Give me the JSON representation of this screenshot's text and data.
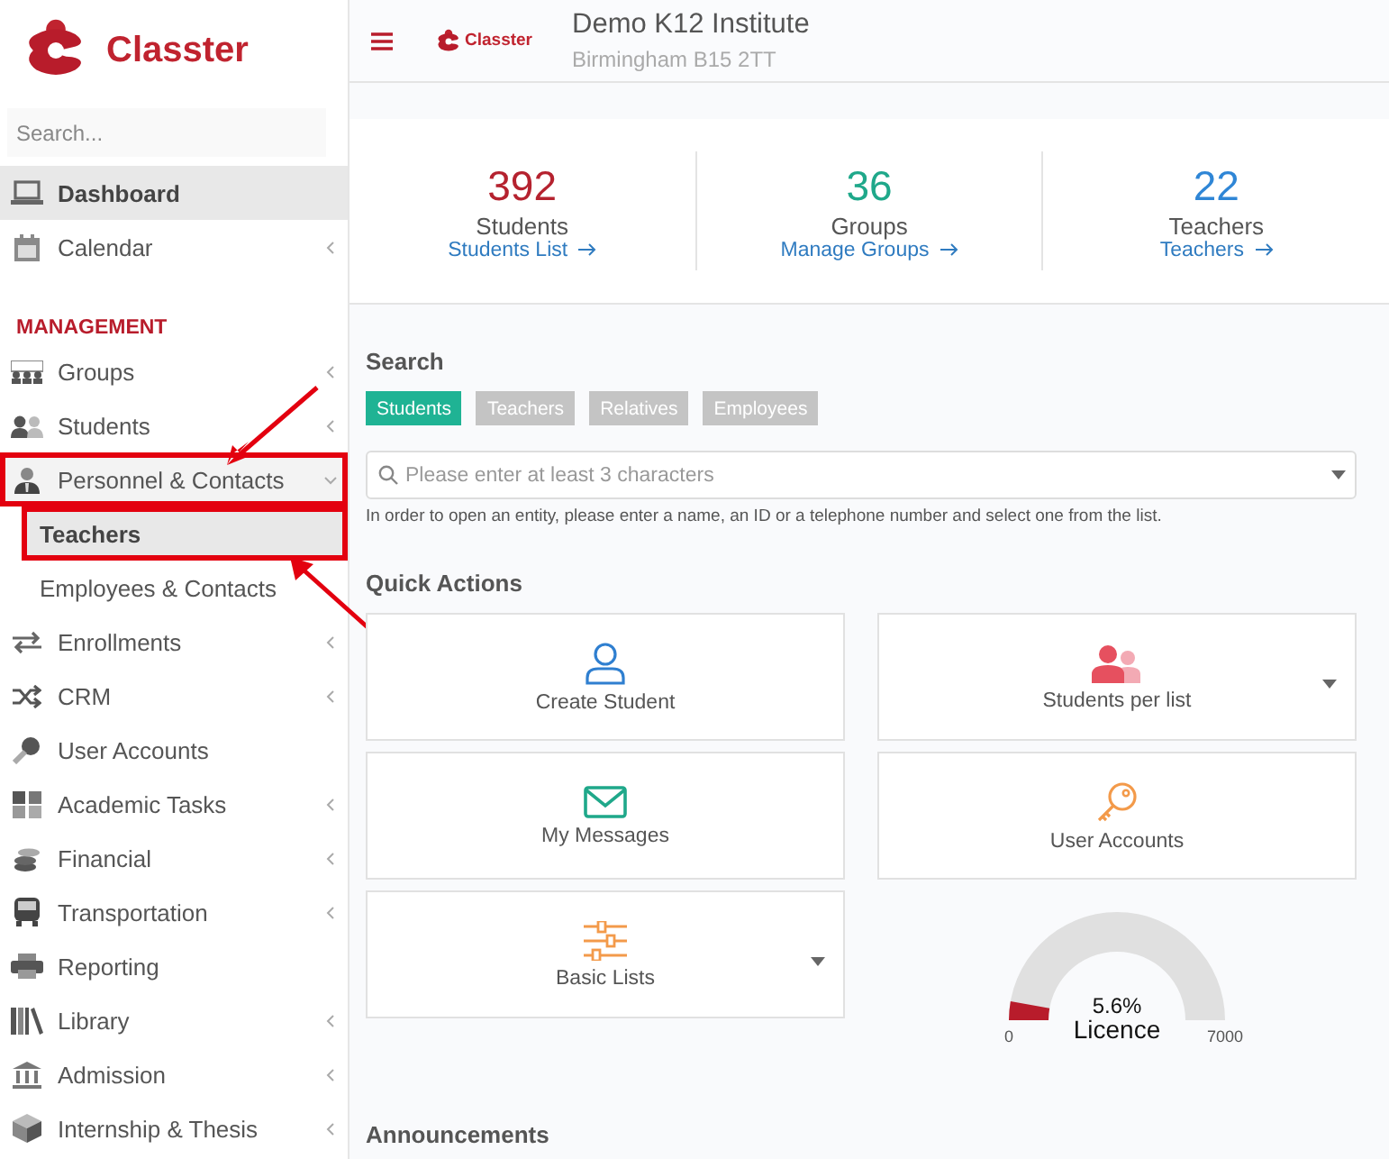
{
  "sidebar": {
    "logo_text": "Classter",
    "search": {
      "placeholder": "Search..."
    },
    "items": [
      {
        "kind": "item",
        "label": "Dashboard",
        "selected": true,
        "expandable": false,
        "highlighted": false
      },
      {
        "kind": "item",
        "label": "Calendar",
        "selected": false,
        "expandable": true,
        "expanded": false,
        "highlighted": false
      },
      {
        "kind": "section",
        "label": "MANAGEMENT"
      },
      {
        "kind": "item",
        "label": "Groups",
        "selected": false,
        "expandable": true,
        "expanded": false,
        "highlighted": false
      },
      {
        "kind": "item",
        "label": "Students",
        "selected": false,
        "expandable": true,
        "expanded": false,
        "highlighted": false
      },
      {
        "kind": "item",
        "label": "Personnel & Contacts",
        "selected": false,
        "expandable": true,
        "expanded": true,
        "highlighted": true
      },
      {
        "kind": "subitem",
        "label": "Teachers",
        "selected": true,
        "highlighted": true
      },
      {
        "kind": "subitem",
        "label": "Employees & Contacts",
        "selected": false,
        "highlighted": false
      },
      {
        "kind": "item",
        "label": "Enrollments",
        "selected": false,
        "expandable": true,
        "expanded": false,
        "highlighted": false
      },
      {
        "kind": "item",
        "label": "CRM",
        "selected": false,
        "expandable": true,
        "expanded": false,
        "highlighted": false
      },
      {
        "kind": "item",
        "label": "User Accounts",
        "selected": false,
        "expandable": false,
        "highlighted": false
      },
      {
        "kind": "item",
        "label": "Academic Tasks",
        "selected": false,
        "expandable": true,
        "expanded": false,
        "highlighted": false
      },
      {
        "kind": "item",
        "label": "Financial",
        "selected": false,
        "expandable": true,
        "expanded": false,
        "highlighted": false
      },
      {
        "kind": "item",
        "label": "Transportation",
        "selected": false,
        "expandable": true,
        "expanded": false,
        "highlighted": false
      },
      {
        "kind": "item",
        "label": "Reporting",
        "selected": false,
        "expandable": false,
        "highlighted": false
      },
      {
        "kind": "item",
        "label": "Library",
        "selected": false,
        "expandable": true,
        "expanded": false,
        "highlighted": false
      },
      {
        "kind": "item",
        "label": "Admission",
        "selected": false,
        "expandable": true,
        "expanded": false,
        "highlighted": false
      },
      {
        "kind": "item",
        "label": "Internship & Thesis",
        "selected": false,
        "expandable": true,
        "expanded": false,
        "highlighted": false
      }
    ]
  },
  "header": {
    "logo_text": "Classter",
    "title": "Demo K12 Institute",
    "subtitle": "Birmingham B15 2TT"
  },
  "stats": [
    {
      "value": "392",
      "label": "Students",
      "link": "Students List",
      "color": "#b5222f"
    },
    {
      "value": "36",
      "label": "Groups",
      "link": "Manage Groups",
      "color": "#1fa88a"
    },
    {
      "value": "22",
      "label": "Teachers",
      "link": "Teachers",
      "color": "#2f86d6"
    }
  ],
  "search": {
    "title": "Search",
    "tabs": [
      {
        "label": "Students",
        "selected": true
      },
      {
        "label": "Teachers",
        "selected": false
      },
      {
        "label": "Relatives",
        "selected": false
      },
      {
        "label": "Employees",
        "selected": false
      }
    ],
    "placeholder": "Please enter at least 3 characters",
    "help": "In order to open an entity, please enter a name, an ID or a telephone number and select one from the list."
  },
  "quick_actions": {
    "title": "Quick Actions",
    "tiles": [
      {
        "label": "Create Student",
        "dropdown": false
      },
      {
        "label": "Students per list",
        "dropdown": true
      },
      {
        "label": "My Messages",
        "dropdown": false
      },
      {
        "label": "User Accounts",
        "dropdown": false
      },
      {
        "label": "Basic Lists",
        "dropdown": true
      }
    ]
  },
  "licence_gauge": {
    "level": 0.056,
    "reading": "5.6%",
    "label": "Licence",
    "min": "0",
    "max": "7000"
  },
  "announcements": {
    "title": "Announcements"
  }
}
